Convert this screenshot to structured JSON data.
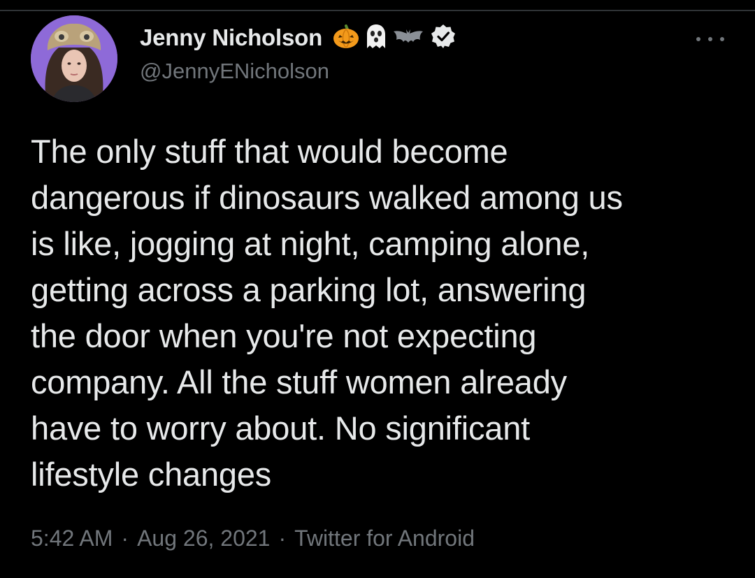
{
  "tweet": {
    "author": {
      "display_name": "Jenny Nicholson",
      "handle": "@JennyENicholson",
      "name_emojis": [
        "pumpkin-icon",
        "ghost-icon",
        "bat-icon"
      ],
      "verified": true,
      "avatar": "profile-photo"
    },
    "more_icon": "more-options-icon",
    "text_lines": [
      "The only stuff that would become",
      "dangerous if dinosaurs walked among us",
      "is like, jogging at night, camping alone,",
      "getting across a parking lot, answering",
      "the door when you're not expecting",
      "company. All the stuff women already",
      "have to worry about. No significant",
      "lifestyle changes"
    ],
    "time": "5:42 AM",
    "separator": "·",
    "date": "Aug 26, 2021",
    "source": "Twitter for Android"
  },
  "colors": {
    "background": "#000000",
    "primary_text": "#e7e9ea",
    "secondary_text": "#71767b",
    "avatar_background": "#8e6ad8",
    "divider": "#2f3336"
  }
}
